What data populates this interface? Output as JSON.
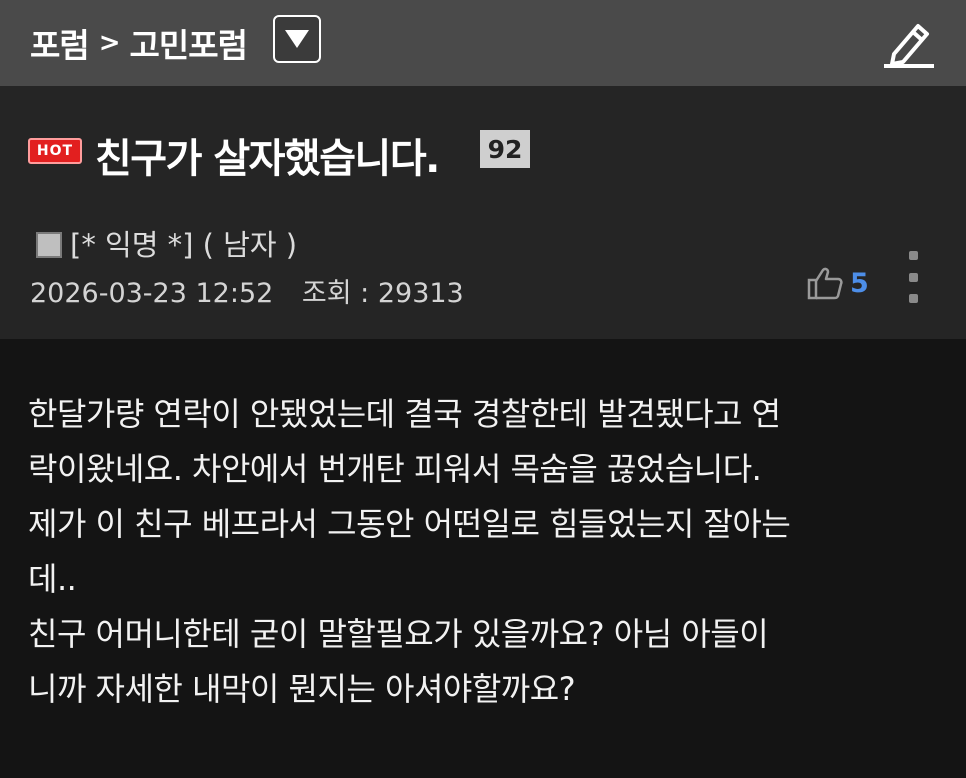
{
  "topbar": {
    "breadcrumb_root": "포럼",
    "breadcrumb_sep": ">",
    "breadcrumb_current": "고민포럼",
    "dropdown_icon": "triangle-down-icon",
    "edit_icon": "pencil-icon"
  },
  "post": {
    "badge": "HOT",
    "title": "친구가 살자했습니다.",
    "comment_count": "92",
    "author": "[* 익명 *] ( 남자 )",
    "datetime": "2026-03-23 12:52",
    "views": "조회 : 29313",
    "likes": "5",
    "like_icon": "thumbs-up-icon",
    "more_icon": "more-vertical-icon",
    "body_lines": [
      "한달가량 연락이 안됐었는데 결국 경찰한테 발견됐다고 연",
      "락이왔네요. 차안에서 번개탄 피워서 목숨을 끊었습니다.",
      "제가 이 친구 베프라서 그동안 어떤일로 힘들었는지 잘아는",
      "데..",
      "친구 어머니한테 굳이 말할필요가 있을까요?  아님 아들이",
      "니까 자세한 내막이 뭔지는 아셔야할까요?"
    ]
  },
  "colors": {
    "topbar": "#4a4a4a",
    "header": "#252525",
    "body": "#141414",
    "hot_badge": "#e21f1f",
    "like_count": "#4d8ee8"
  }
}
